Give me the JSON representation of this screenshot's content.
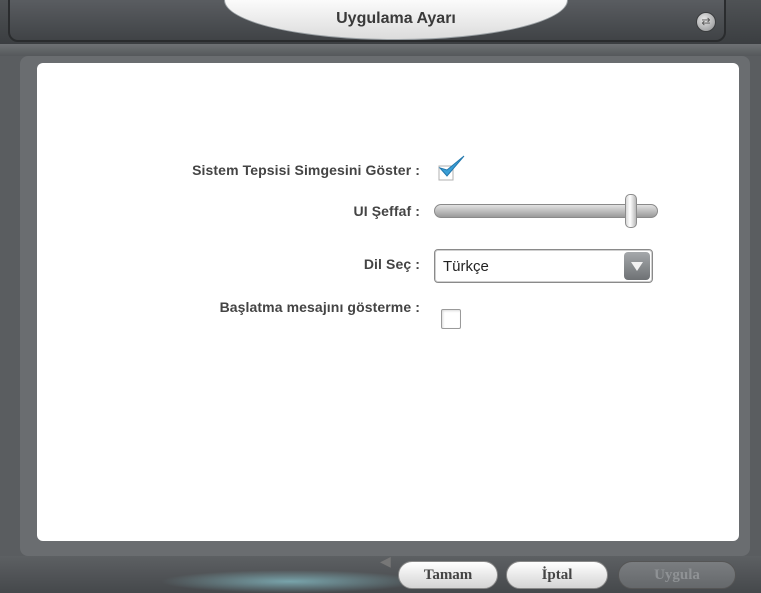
{
  "window": {
    "title": "Uygulama Ayarı"
  },
  "settings": {
    "tray_icon_label": "Sistem Tepsisi Simgesini Göster :",
    "tray_icon_checked": true,
    "transparency_label": "UI Şeffaf :",
    "transparency_value": 0.9,
    "language_label": "Dil Seç :",
    "language_value": "Türkçe",
    "startup_msg_label": "Başlatma mesajını gösterme :",
    "startup_msg_checked": false
  },
  "buttons": {
    "ok": "Tamam",
    "cancel": "İptal",
    "apply": "Uygula",
    "apply_enabled": false
  },
  "colors": {
    "checkmark": "#3a9fd6",
    "panel": "#ffffff"
  },
  "icons": [
    "swap-icon",
    "checkmark-icon",
    "dropdown-arrow-icon",
    "speaker-icon"
  ]
}
